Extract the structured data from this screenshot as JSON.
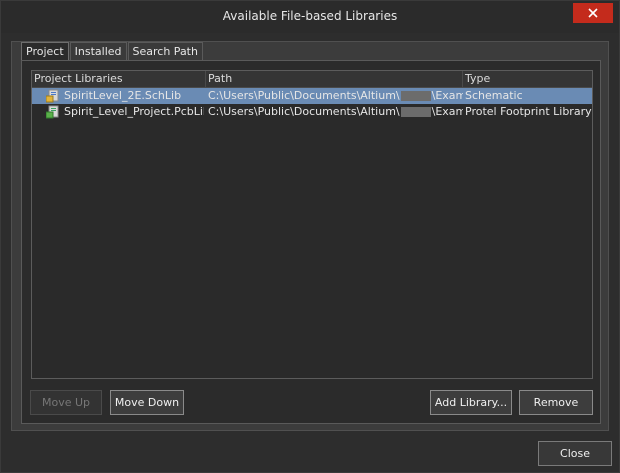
{
  "window": {
    "title": "Available File-based Libraries"
  },
  "tabs": [
    {
      "label": "Project",
      "active": true
    },
    {
      "label": "Installed",
      "active": false
    },
    {
      "label": "Search Path",
      "active": false
    }
  ],
  "table": {
    "columns": [
      "Project Libraries",
      "Path",
      "Type"
    ],
    "rows": [
      {
        "name": "SpiritLevel_2E.SchLib",
        "path_prefix": "C:\\Users\\Public\\Documents\\Altium\\",
        "path_suffix": "\\Example:",
        "type": "Schematic",
        "icon": "schematic-library-icon",
        "selected": true
      },
      {
        "name": "Spirit_Level_Project.PcbLib",
        "path_prefix": "C:\\Users\\Public\\Documents\\Altium\\",
        "path_suffix": "\\Example:",
        "type": "Protel Footprint Library",
        "icon": "pcb-library-icon",
        "selected": false
      }
    ]
  },
  "buttons": {
    "move_up": "Move Up",
    "move_up_enabled": false,
    "move_down": "Move Down",
    "add_library": "Add Library...",
    "remove": "Remove",
    "close": "Close"
  },
  "colors": {
    "selection": "#6a8bb4",
    "title_close": "#c42b1c"
  }
}
